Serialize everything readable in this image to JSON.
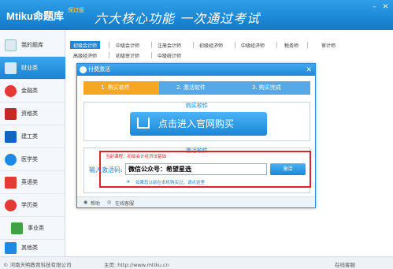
{
  "app": {
    "logo": "Mtiku命题库",
    "logo_badge": "保过版",
    "slogan": "六大核心功能 一次通过考试"
  },
  "sidebar": {
    "items": [
      {
        "label": "我的题库",
        "color": "#2a6fb3"
      },
      {
        "label": "财业类",
        "color": "#ffffff"
      },
      {
        "label": "金融类",
        "color": "#e53935"
      },
      {
        "label": "资格类",
        "color": "#c62828"
      },
      {
        "label": "建工类",
        "color": "#1565c0"
      },
      {
        "label": "医学类",
        "color": "#1e88e5"
      },
      {
        "label": "英语类",
        "color": "#e53935"
      },
      {
        "label": "学历类",
        "color": "#e53935"
      },
      {
        "label": "事业类",
        "color": "#43a047"
      },
      {
        "label": "其他类",
        "color": "#1e88e5"
      }
    ]
  },
  "categories": {
    "row1": [
      "初级会计师",
      "中级会计师",
      "注册会计师",
      "初级经济师",
      "中级经济师",
      "税务师",
      "审计师"
    ],
    "row2": [
      "高级经济师",
      "初级审计师",
      "中级统计师"
    ]
  },
  "dialog": {
    "title": "付费激活",
    "steps": [
      "1. 购买软件",
      "2. 激活软件",
      "3. 购买完成"
    ],
    "buy_section": "购买软件",
    "buy_button": "点击进入官网购买",
    "activate_section": "激活软件",
    "current_course": "当前课程：初级会计经济法基础",
    "input_label": "输入激活码:",
    "code_value": "微信公众号：希望星选",
    "activate_button": "激活",
    "hint": "如果您以前在本机购买过，请点这里",
    "footer_help": "帮助",
    "footer_service": "在线客服"
  },
  "statusbar": {
    "copyright": "© 河南天明教育科技有限公司",
    "homepage": "主页: http://www.mtiku.cn",
    "online": "在线客服"
  },
  "colors": {
    "primary": "#1e88d8",
    "step_active": "#f5a623",
    "highlight": "#d8262a"
  }
}
